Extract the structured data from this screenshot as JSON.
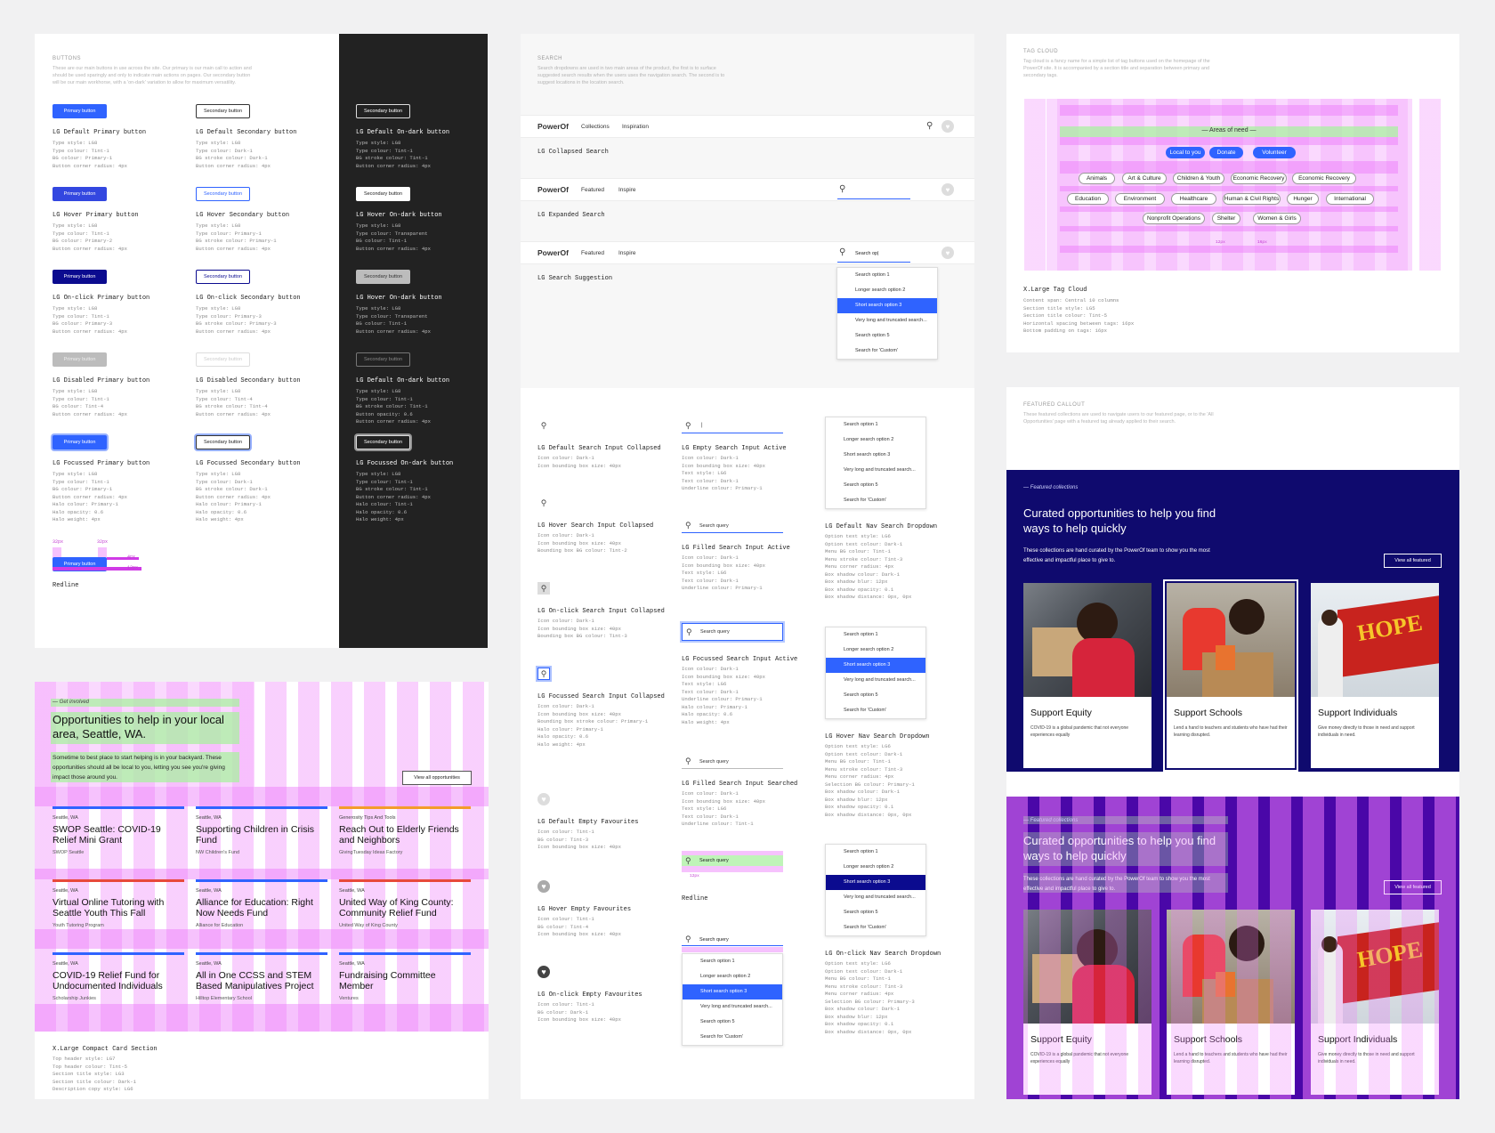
{
  "buttons": {
    "title": "BUTTONS",
    "desc": "These are our main buttons in use across the site. Our primary is our main call to action and should be used sparingly and only to indicate main actions on pages. Our secondary button will be our main workhorse, with a 'on-dark' variation to allow for maximum versatility.",
    "primary_label": "Primary button",
    "secondary_label": "Secondary button",
    "states": [
      {
        "p": "LG Default Primary button",
        "s": "LG Default Secondary button",
        "d": "LG Default On-dark button",
        "ps": "Type style: LG8\nType colour: Tint-1\nBG colour: Primary-1\nButton corner radius: 4px",
        "ss": "Type style: LG8\nType colour: Dark-1\nBG stroke colour: Dark-1\nButton corner radius: 4px",
        "ds": "Type style: LG8\nType colour: Tint-1\nBG stroke colour: Tint-1\nButton corner radius: 4px"
      },
      {
        "p": "LG Hover Primary button",
        "s": "LG Hover Secondary button",
        "d": "LG Hover On-dark button",
        "ps": "Type style: LG8\nType colour: Tint-1\nBG colour: Primary-2\nButton corner radius: 4px",
        "ss": "Type style: LG8\nType colour: Primary-1\nBG stroke colour: Primary-1\nButton corner radius: 4px",
        "ds": "Type style: LG8\nType colour: Transparent\nBG colour: Tint-1\nButton corner radius: 4px"
      },
      {
        "p": "LG On-click Primary button",
        "s": "LG On-click Secondary button",
        "d": "LG Hover On-dark button",
        "ps": "Type style: LG8\nType colour: Tint-1\nBG colour: Primary-3\nButton corner radius: 4px",
        "ss": "Type style: LG8\nType colour: Primary-3\nBG stroke colour: Primary-3\nButton corner radius: 4px",
        "ds": "Type style: LG8\nType colour: Transparent\nBG colour: Tint-1\nButton corner radius: 4px"
      },
      {
        "p": "LG Disabled Primary button",
        "s": "LG Disabled Secondary button",
        "d": "LG Default On-dark button",
        "ps": "Type style: LG8\nType colour: Tint-1\nBG colour: Tint-4\nButton corner radius: 4px",
        "ss": "Type style: LG8\nType colour: Tint-4\nBG stroke colour: Tint-4\nButton corner radius: 4px",
        "ds": "Type style: LG8\nType colour: Tint-1\nBG stroke colour: Tint-1\nButton opacity: 0.6\nButton corner radius: 4px"
      },
      {
        "p": "LG Focussed Primary button",
        "s": "LG Focussed Secondary button",
        "d": "LG Focussed On-dark button",
        "ps": "Type style: LG8\nType colour: Tint-1\nBG colour: Primary-1\nButton corner radius: 4px\nHalo colour: Primary-1\nHalo opacity: 0.6\nHalo weight: 4px",
        "ss": "Type style: LG8\nType colour: Dark-1\nBG stroke colour: Dark-1\nButton corner radius: 4px\nHalo colour: Primary-1\nHalo opacity: 0.6\nHalo weight: 4px",
        "ds": "Type style: LG8\nType colour: Tint-1\nBG stroke colour: Tint-1\nButton corner radius: 4px\nHalo colour: Tint-1\nHalo opacity: 0.6\nHalo weight: 4px"
      }
    ],
    "redline": "Redline",
    "r1": "32px",
    "r2": "32px",
    "r3": "4px",
    "r4": "12px"
  },
  "search": {
    "title": "SEARCH",
    "desc": "Search dropdowns are used in two main areas of the product, the first is to surface suggested search results when the users uses the navigation search. The second is to suggest locations in the location search.",
    "logo": "PowerOf",
    "nav1": [
      "Collections",
      "Inspiration"
    ],
    "nav2": [
      "Featured",
      "Inspire"
    ],
    "collapsed": "LG Collapsed Search",
    "expanded": "LG Expanded Search",
    "suggestion": "LG Search Suggestion",
    "typed": "Search op|",
    "options": [
      "Search option 1",
      "Longer search option 2",
      "Short search option 3",
      "Very long and truncated search...",
      "Search option 5",
      "Search for 'Custom'"
    ],
    "col1": [
      {
        "t": "LG Default Search Input Collapsed",
        "s": "Icon colour: Dark-1\nIcon bounding box size: 40px"
      },
      {
        "t": "LG Hover Search Input Collapsed",
        "s": "Icon colour: Dark-1\nIcon bounding box size: 40px\nBounding box BG colour: Tint-2"
      },
      {
        "t": "LG On-click Search Input Collapsed",
        "s": "Icon colour: Dark-1\nIcon bounding box size: 40px\nBounding box BG colour: Tint-3"
      },
      {
        "t": "LG Focussed Search Input Collapsed",
        "s": "Icon colour: Dark-1\nIcon bounding box size: 40px\nBounding box stroke colour: Primary-1\nHalo colour: Primary-1\nHalo opacity: 0.6\nHalo weight: 4px"
      },
      {
        "t": "LG Default Empty Favourites",
        "s": "Icon colour: Tint-1\nBG colour: Tint-3\nIcon bounding box size: 40px"
      },
      {
        "t": "LG Hover Empty Favourites",
        "s": "Icon colour: Tint-1\nBG colour: Tint-4\nIcon bounding box size: 40px"
      },
      {
        "t": "LG On-click Empty Favourites",
        "s": "Icon colour: Tint-1\nBG colour: Dark-1\nIcon bounding box size: 40px"
      }
    ],
    "col2": [
      {
        "t": "LG Empty Search Input Active",
        "s": "Icon colour: Dark-1\nIcon bounding box size: 40px\nText style: LG6\nText colour: Dark-1\nUnderline colour: Primary-1"
      },
      {
        "t": "LG Filled Search Input Active",
        "s": "Icon colour: Dark-1\nIcon bounding box size: 40px\nText style: LG6\nText colour: Dark-1\nUnderline colour: Primary-1"
      },
      {
        "t": "LG Focussed Search Input Active",
        "s": "Icon colour: Dark-1\nIcon bounding box size: 40px\nText style: LG6\nText colour: Dark-1\nUnderline colour: Primary-1\nHalo colour: Primary-1\nHalo opacity: 0.6\nHalo weight: 4px"
      },
      {
        "t": "LG Filled Search Input Searched",
        "s": "Icon colour: Dark-1\nIcon bounding box size: 40px\nText style: LG6\nText colour: Dark-1\nUnderline colour: Tint-1"
      }
    ],
    "query": "Search query",
    "redline": "Redline",
    "r12": "12px",
    "col3": [
      {
        "t": "LG Default Nav Search Dropdown",
        "s": "Option text style: LG6\nOption text colour: Dark-1\nMenu BG colour: Tint-1\nMenu stroke colour: Tint-3\nMenu corner radius: 4px\nBox shadow colour: Dark-1\nBox shadow blur: 12px\nBox shadow opacity: 0.1\nBox shadow distance: 0px, 0px"
      },
      {
        "t": "LG Hover Nav Search Dropdown",
        "s": "Option text style: LG6\nOption text colour: Dark-1\nMenu BG colour: Tint-1\nMenu stroke colour: Tint-3\nMenu corner radius: 4px\nSelection BG colour: Primary-1\nBox shadow colour: Dark-1\nBox shadow blur: 12px\nBox shadow opacity: 0.1\nBox shadow distance: 0px, 0px"
      },
      {
        "t": "LG On-click Nav Search Dropdown",
        "s": "Option text style: LG6\nOption text colour: Dark-1\nMenu BG colour: Tint-1\nMenu stroke colour: Tint-3\nMenu corner radius: 4px\nSelection BG colour: Primary-3\nBox shadow colour: Dark-1\nBox shadow blur: 12px\nBox shadow opacity: 0.1\nBox shadow distance: 0px, 0px"
      }
    ]
  },
  "tagcloud": {
    "title": "TAG CLOUD",
    "desc": "Tag cloud is a fancy name for a simple list of tag buttons used on the homepage of the PowerOf site. It is accompanied by a section title and separation between primary and secondary tags.",
    "heading": "— Areas of need —",
    "primary": [
      "Local to you",
      "Donate",
      "Volunteer"
    ],
    "row1": [
      "Animals",
      "Art & Culture",
      "Children & Youth",
      "Economic Recovery",
      "Economic Recovery"
    ],
    "row2": [
      "Education",
      "Environment",
      "Healthcare",
      "Human & Civil Rights",
      "Hunger",
      "International"
    ],
    "row3": [
      "Nonprofit Operations",
      "Shelter",
      "Women & Girls"
    ],
    "m1": "12px",
    "m2": "16px",
    "label": "X.Large Tag Cloud",
    "specs": "Content span: Central 10 columns\nSection title style: LG5\nSection title colour: Tint-5\nHorizontal spacing between tags: 16px\nBottom padding on tags: 16px"
  },
  "featured": {
    "title": "FEATURED CALLOUT",
    "desc": "These featured collections are used to navigate users to our featured page, or to the 'All Opportunities' page with a featured tag already applied to their search.",
    "kicker": "— Featured collections",
    "heading": "Curated opportunities to help you find ways to help quickly",
    "body": "These collections are hand curated by the PowerOf team to show you the most effective and impactful place to give to.",
    "view_all": "View all featured",
    "cards": [
      {
        "t": "Support Equity",
        "d": "COVID-19 is a global pandemic that not everyone experiences equally"
      },
      {
        "t": "Support Schools",
        "d": "Lend a hand to teachers and students who have had their learning disrupted."
      },
      {
        "t": "Support Individuals",
        "d": "Give money directly to those in need and support individuals in need."
      }
    ],
    "truck": "HOPE"
  },
  "compact": {
    "kicker": "— Get involved",
    "heading": "Opportunities to help in your local area, Seattle, WA.",
    "body": "Sometime to best place to start helping is in your backyard. These opportunities should all be local to you, letting you see you're giving impact those around you.",
    "view_all": "View all opportunities",
    "cards": [
      {
        "loc": "Seattle, WA",
        "t": "SWOP Seattle: COVID-19 Relief Mini Grant",
        "o": "SWOP Seattle",
        "c": "#2f63ff"
      },
      {
        "loc": "Seattle, WA",
        "t": "Supporting Children in Crisis Fund",
        "o": "NW Children's Fund",
        "c": "#2f63ff"
      },
      {
        "loc": "Generosity Tips And Tools",
        "t": "Reach Out to Elderly Friends and Neighbors",
        "o": "GivingTuesday Ideas Factory",
        "c": "#f39c2b"
      },
      {
        "loc": "Seattle, WA",
        "t": "Virtual Online Tutoring with Seattle Youth This Fall",
        "o": "Youth Tutoring Program",
        "c": "#e8493a"
      },
      {
        "loc": "Seattle, WA",
        "t": "Alliance for Education: Right Now Needs Fund",
        "o": "Alliance for Education",
        "c": "#2f63ff"
      },
      {
        "loc": "Seattle, WA",
        "t": "United Way of King County: Community Relief Fund",
        "o": "United Way of King County",
        "c": "#e8493a"
      },
      {
        "loc": "Seattle, WA",
        "t": "COVID-19 Relief Fund for Undocumented Individuals",
        "o": "Scholarship Junkies",
        "c": "#2f63ff"
      },
      {
        "loc": "Seattle, WA",
        "t": "All in One CCSS and STEM Based Manipulatives Project",
        "o": "Hilltop Elementary School",
        "c": "#2f63ff"
      },
      {
        "loc": "Seattle, WA",
        "t": "Fundraising Committee Member",
        "o": "Ventures",
        "c": "#2f63ff"
      }
    ],
    "label": "X.Large Compact Card Section",
    "specs": "Top header style: LG7\nTop header colour: Tint-5\nSection title style: LG3\nSection title colour: Dark-1\nDescription copy style: LG6"
  }
}
